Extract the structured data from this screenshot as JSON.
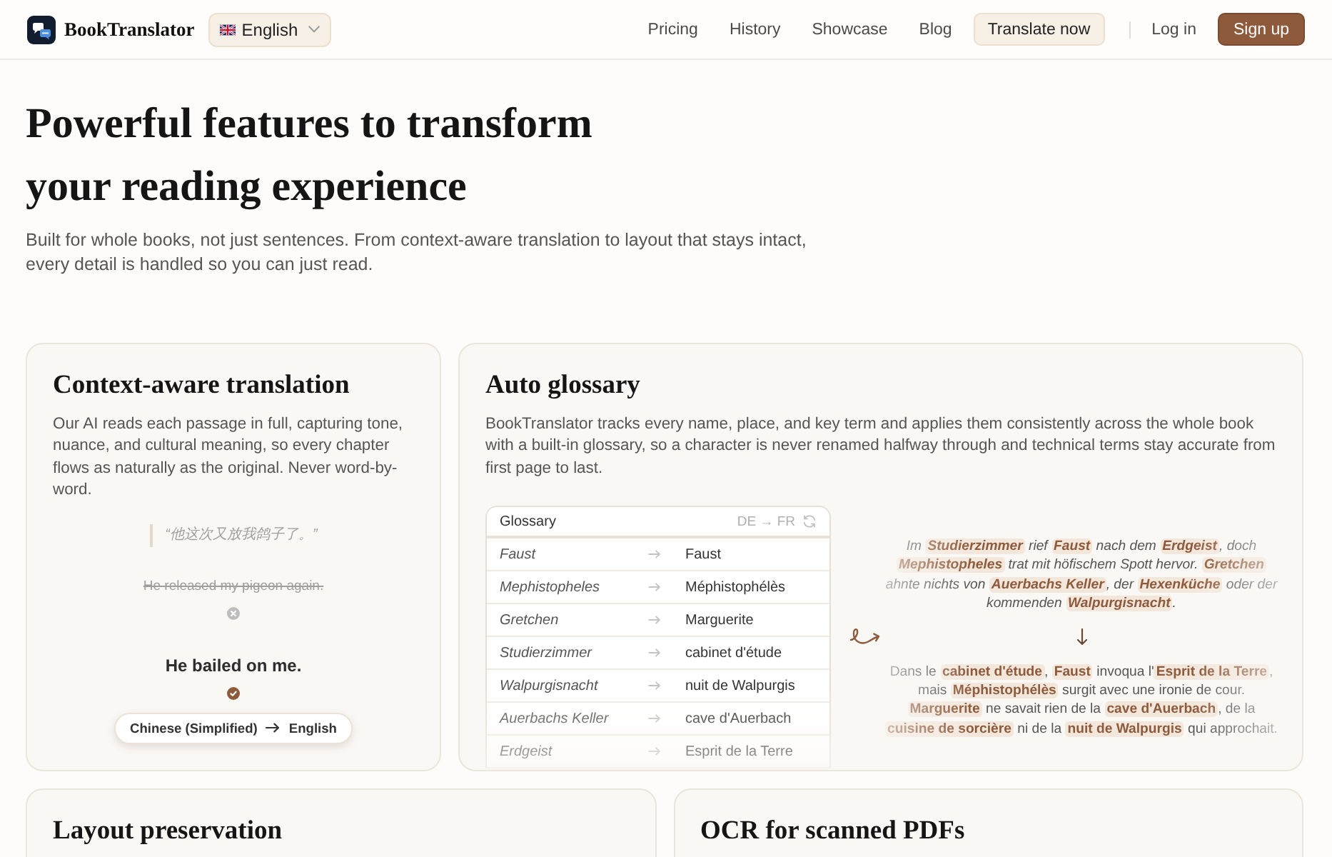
{
  "header": {
    "brand": "BookTranslator",
    "language_selector": {
      "label": "English"
    },
    "nav": [
      {
        "label": "Pricing",
        "kind": "link"
      },
      {
        "label": "History",
        "kind": "link"
      },
      {
        "label": "Showcase",
        "kind": "link"
      },
      {
        "label": "Blog",
        "kind": "link"
      },
      {
        "label": "Translate now",
        "kind": "button"
      }
    ],
    "account": [
      {
        "label": "Log in",
        "kind": "link"
      },
      {
        "label": "Sign up",
        "kind": "primary"
      }
    ]
  },
  "hero": {
    "title": "Powerful features to transform your reading experience",
    "subtitle": "Built for whole books, not just sentences. From context-aware translation to layout that stays intact, every detail is handled so you can just read."
  },
  "features": [
    {
      "kind": "context",
      "title": "Context-aware translation",
      "description": "Our AI reads each passage in full, capturing tone, nuance, and cultural meaning, so every chapter flows as naturally as the original. Never word-by-word.",
      "demo": {
        "quote": "“他这次又放我鸽子了。”",
        "lines": [
          {
            "text": "He released my pigeon again.",
            "kind": "rejected"
          },
          {
            "text": "He bailed on me.",
            "kind": "accepted"
          }
        ],
        "source_language": "Chinese (Simplified)",
        "target_language": "English"
      }
    },
    {
      "kind": "glossary",
      "title": "Auto glossary",
      "description": "BookTranslator tracks every name, place, and key term and applies them consistently across the whole book with a built-in glossary, so a character is never renamed halfway through and technical terms stay accurate from first page to last.",
      "glossary": {
        "title": "Glossary",
        "pair": "DE → FR",
        "rows": [
          {
            "source": "Faust",
            "target": "Faust"
          },
          {
            "source": "Mephistopheles",
            "target": "Méphistophélès"
          },
          {
            "source": "Gretchen",
            "target": "Marguerite"
          },
          {
            "source": "Studierzimmer",
            "target": "cabinet d'étude"
          },
          {
            "source": "Walpurgisnacht",
            "target": "nuit de Walpurgis"
          },
          {
            "source": "Auerbachs Keller",
            "target": "cave d'Auerbach"
          },
          {
            "source": "Erdgeist",
            "target": "Esprit de la Terre"
          }
        ]
      },
      "source_passage": "Im **Studierzimmer** rief **Faust** nach dem **Erdgeist**, doch **Mephistopheles** trat mit höfischem Spott hervor. **Gretchen** ahnte nichts von **Auerbachs Keller**, der **Hexenküche** oder der kommenden **Walpurgisnacht**.",
      "target_passage": "Dans le **cabinet d'étude**, **Faust** invoqua l'**Esprit de la Terre**, mais **Méphistophélès** surgit avec une ironie de cour. **Marguerite** ne savait rien de la **cave d'Auerbach**, de la **cuisine de sorcière** ni de la **nuit de Walpurgis** qui approchait."
    },
    {
      "kind": "plain",
      "title": "Layout preservation"
    },
    {
      "kind": "plain",
      "title": "OCR for scanned PDFs"
    }
  ]
}
